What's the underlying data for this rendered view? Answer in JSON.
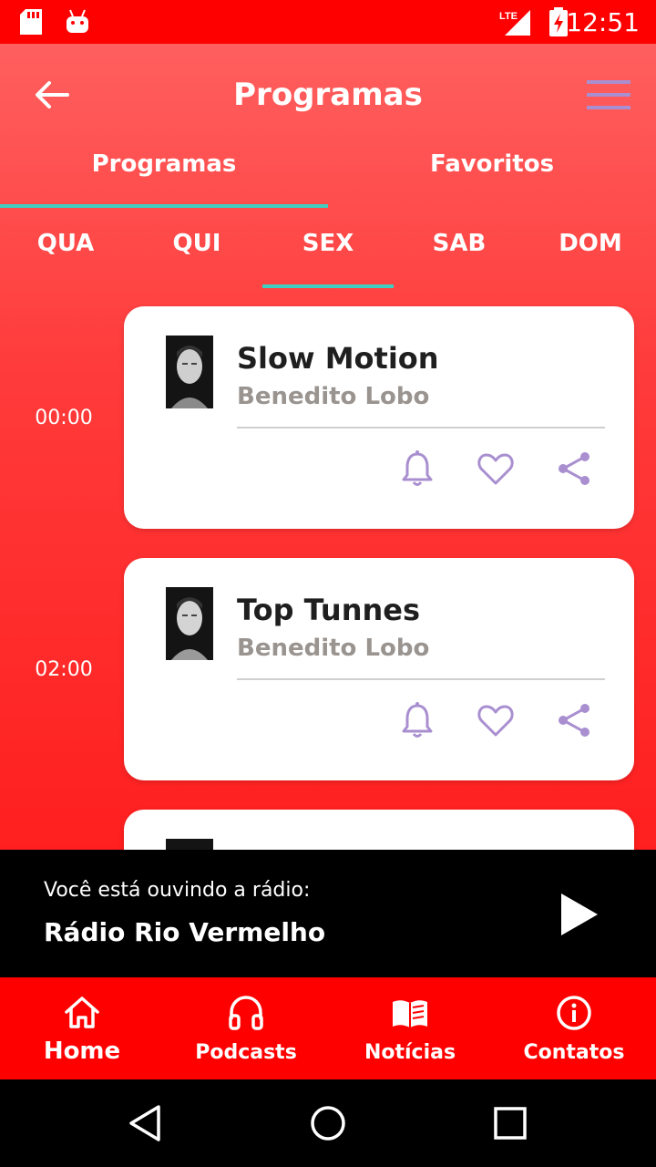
{
  "status_bar": {
    "time": "12:51",
    "network": "LTE"
  },
  "app_bar": {
    "title": "Programas"
  },
  "tabs": [
    {
      "label": "Programas",
      "selected": true
    },
    {
      "label": "Favoritos",
      "selected": false
    }
  ],
  "days": [
    {
      "label": "QUA"
    },
    {
      "label": "QUI"
    },
    {
      "label": "SEX",
      "selected": true
    },
    {
      "label": "SAB"
    },
    {
      "label": "DOM"
    }
  ],
  "programs": [
    {
      "time": "00:00",
      "name": "Slow Motion",
      "host": "Benedito Lobo"
    },
    {
      "time": "02:00",
      "name": "Top Tunnes",
      "host": "Benedito Lobo"
    },
    {
      "time": "",
      "name": "",
      "host": ""
    }
  ],
  "player": {
    "label": "Você está ouvindo a rádio:",
    "station": "Rádio Rio Vermelho"
  },
  "bottom_nav": [
    {
      "label": "Home",
      "icon": "home-icon",
      "active": true
    },
    {
      "label": "Podcasts",
      "icon": "headphones-icon"
    },
    {
      "label": "Notícias",
      "icon": "book-icon"
    },
    {
      "label": "Contatos",
      "icon": "info-icon"
    }
  ],
  "colors": {
    "primary": "#ff0000",
    "accent": "#3ecfc0",
    "icon_tint": "#a98fd0"
  }
}
